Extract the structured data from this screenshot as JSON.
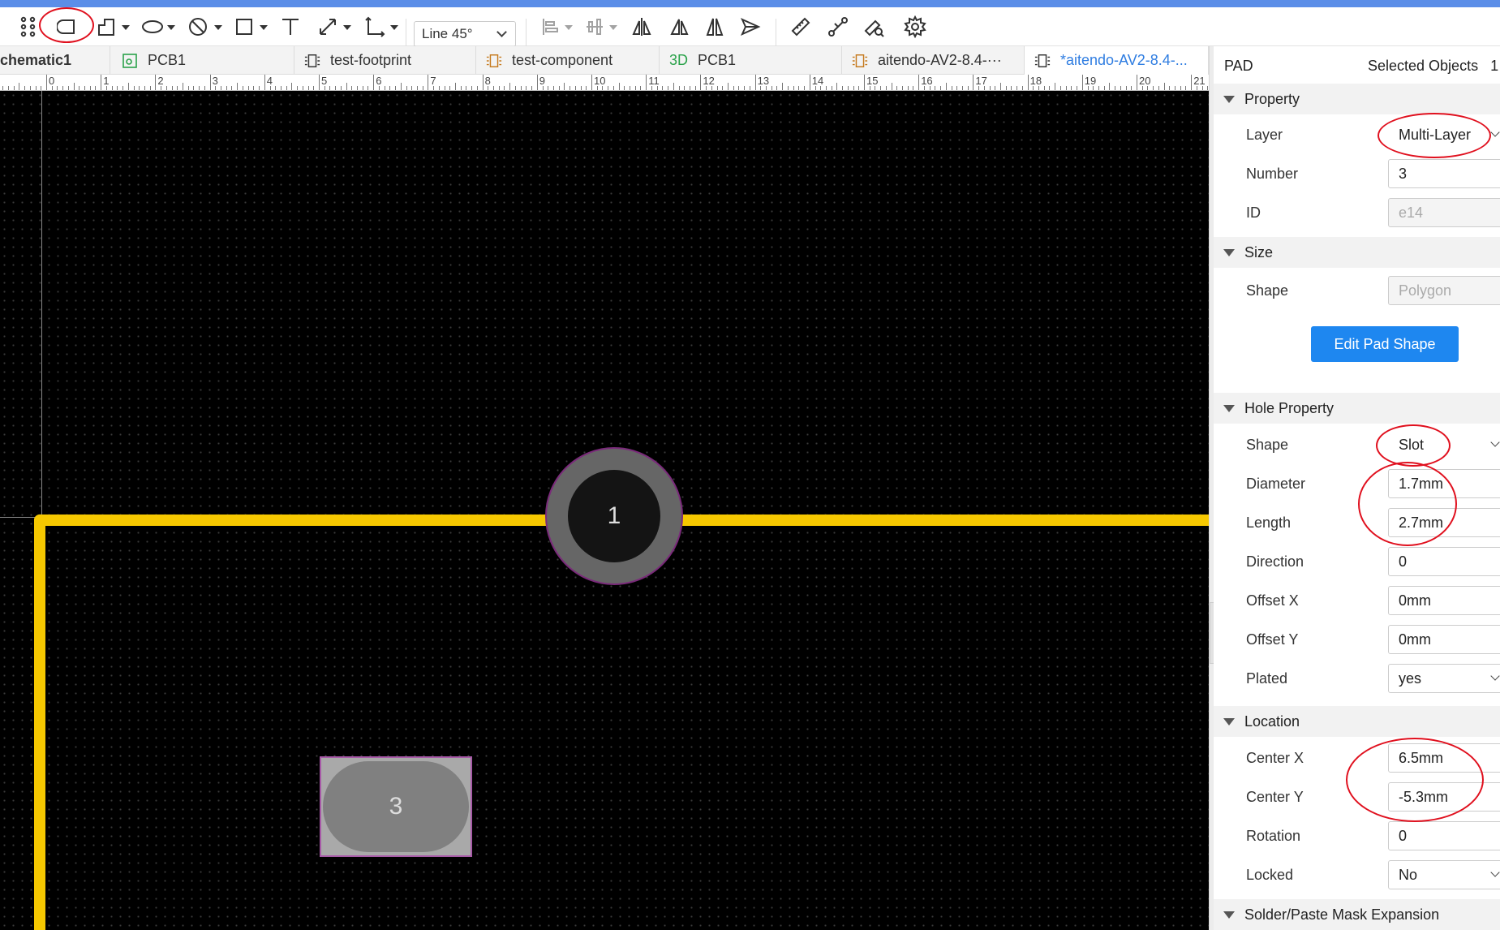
{
  "toolbar": {
    "line_mode": "Line 45°",
    "icons": [
      "grip-icon",
      "pad-rounded-rect-icon",
      "polyline-icon",
      "ellipse-icon",
      "circle-slash-icon",
      "rectangle-icon",
      "text-icon",
      "dimension-icon",
      "angle-dimension-icon",
      "align-icon",
      "distribute-icon",
      "flip-horizontal-icon",
      "flip-vertical-icon",
      "mirror-icon",
      "send-icon",
      "ruler-icon",
      "connect-icon",
      "check-icon",
      "settings-icon"
    ]
  },
  "tabs": [
    {
      "label": "chematic1",
      "icon": "schematic-icon"
    },
    {
      "label": "PCB1",
      "icon": "pcb-icon"
    },
    {
      "label": "test-footprint",
      "icon": "footprint-icon"
    },
    {
      "label": "test-component",
      "icon": "component-icon"
    },
    {
      "label": "PCB1",
      "icon": "3d-icon",
      "prefix": "3D"
    },
    {
      "label": "aitendo-AV2-8.4-···",
      "icon": "component-icon"
    },
    {
      "label": "*aitendo-AV2-8.4-...",
      "icon": "footprint-icon"
    }
  ],
  "ruler": {
    "labels": [
      "0",
      "1",
      "2",
      "3",
      "4",
      "5",
      "6",
      "7",
      "8",
      "9",
      "10",
      "11",
      "12",
      "13",
      "14",
      "15",
      "16",
      "17",
      "18",
      "19",
      "20",
      "21"
    ]
  },
  "canvas": {
    "pad1_label": "1",
    "pad3_label": "3"
  },
  "panel": {
    "title": "PAD",
    "selected_label": "Selected Objects",
    "selected_count": "1",
    "sections": {
      "property": "Property",
      "size": "Size",
      "hole": "Hole Property",
      "location": "Location",
      "mask": "Solder/Paste Mask Expansion"
    },
    "layer": {
      "label": "Layer",
      "value": "Multi-Layer"
    },
    "number": {
      "label": "Number",
      "value": "3"
    },
    "id": {
      "label": "ID",
      "value": "e14"
    },
    "shape": {
      "label": "Shape",
      "value": "Polygon"
    },
    "edit_pad_shape": "Edit Pad Shape",
    "hole_shape": {
      "label": "Shape",
      "value": "Slot"
    },
    "diameter": {
      "label": "Diameter",
      "value": "1.7mm"
    },
    "length": {
      "label": "Length",
      "value": "2.7mm"
    },
    "direction": {
      "label": "Direction",
      "value": "0"
    },
    "offset_x": {
      "label": "Offset X",
      "value": "0mm"
    },
    "offset_y": {
      "label": "Offset Y",
      "value": "0mm"
    },
    "plated": {
      "label": "Plated",
      "value": "yes"
    },
    "center_x": {
      "label": "Center X",
      "value": "6.5mm"
    },
    "center_y": {
      "label": "Center Y",
      "value": "-5.3mm"
    },
    "rotation": {
      "label": "Rotation",
      "value": "0"
    },
    "locked": {
      "label": "Locked",
      "value": "No"
    }
  },
  "colors": {
    "board_outline": "#f6c800",
    "accent": "#1e87f0",
    "annotation": "#e0101e"
  }
}
